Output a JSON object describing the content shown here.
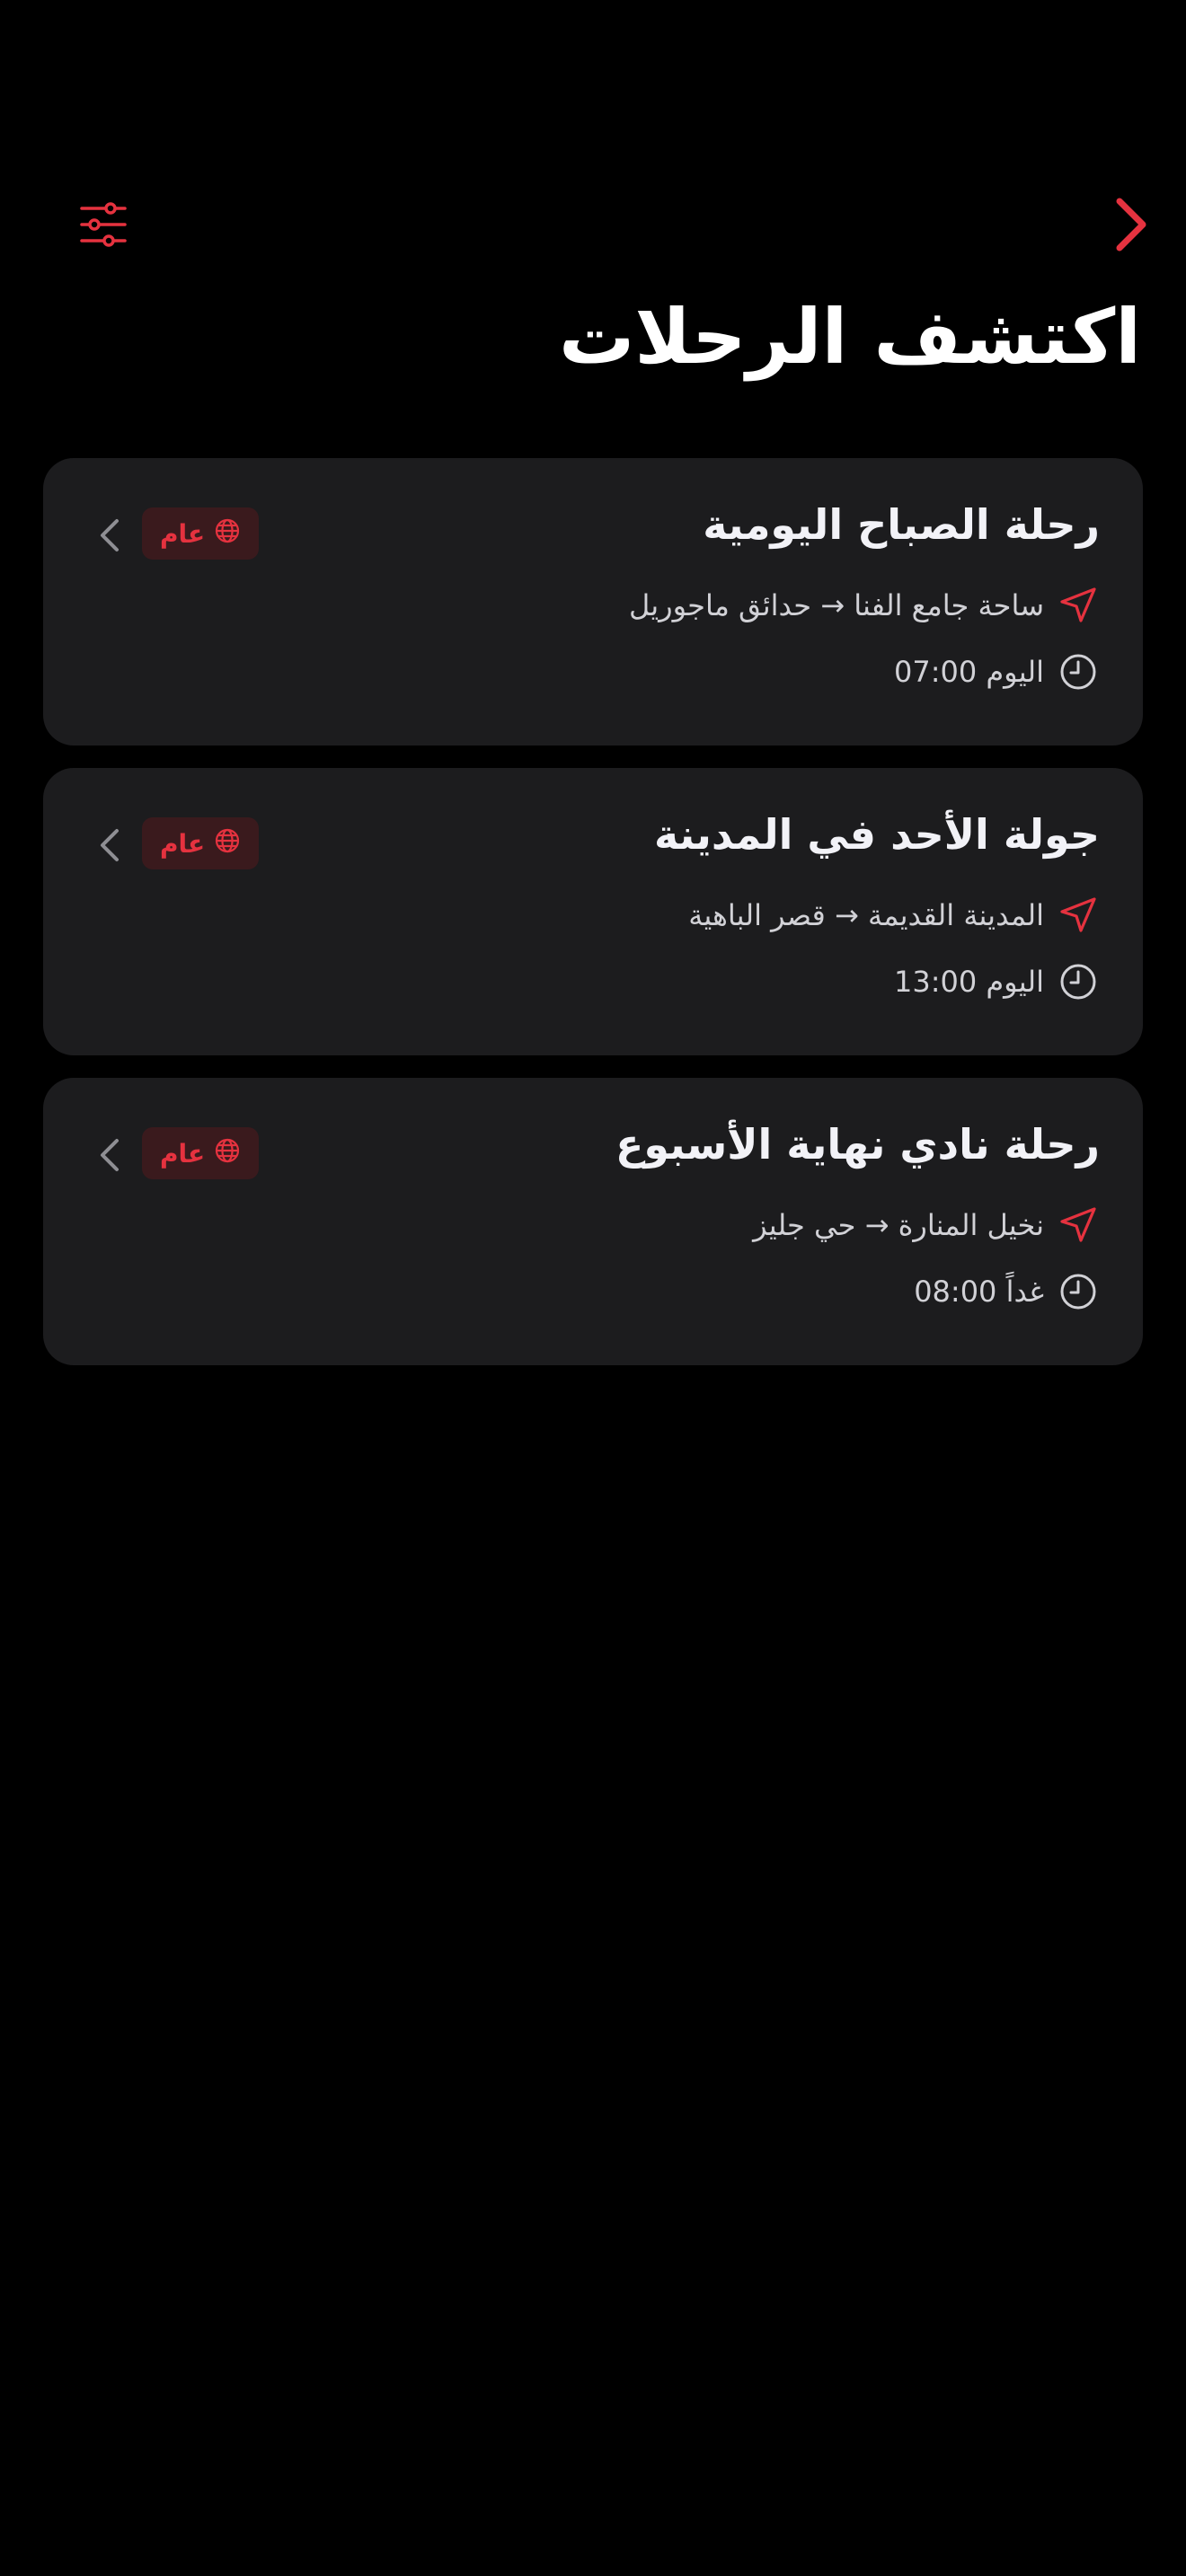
{
  "colors": {
    "accent": "#e5323f",
    "background": "#000000",
    "card": "#1c1c1e",
    "badge_bg": "#3a1a1d",
    "text_primary": "#f2f2f7",
    "text_secondary": "#d1d1d6"
  },
  "nav": {
    "back_icon": "chevron-right-icon",
    "filter_icon": "sliders-icon"
  },
  "header": {
    "title": "اكتشف الرحلات"
  },
  "trips": [
    {
      "name": "رحلة الصباح اليومية",
      "route": "ساحة جامع الفنا → حدائق ماجوريل",
      "time": "اليوم 07:00",
      "badge": "عام"
    },
    {
      "name": "جولة الأحد في المدينة",
      "route": "المدينة القديمة → قصر الباهية",
      "time": "اليوم 13:00",
      "badge": "عام"
    },
    {
      "name": "رحلة نادي نهاية الأسبوع",
      "route": "نخيل المنارة → حي جليز",
      "time": "غداً 08:00",
      "badge": "عام"
    }
  ]
}
